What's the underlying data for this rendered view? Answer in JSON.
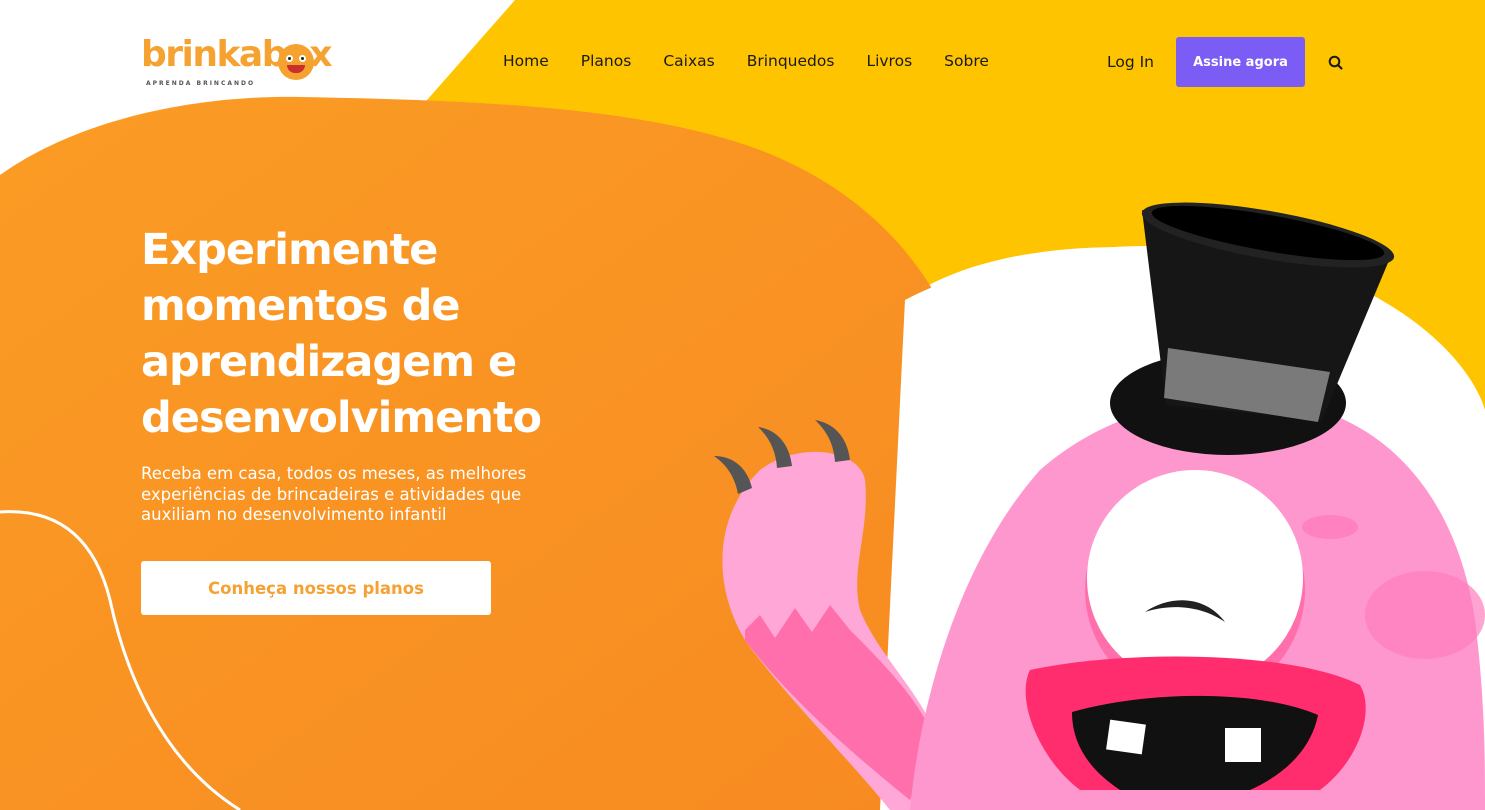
{
  "brand": {
    "name": "brinkabox",
    "tagline": "APRENDA BRINCANDO"
  },
  "nav": {
    "items": [
      {
        "label": "Home"
      },
      {
        "label": "Planos"
      },
      {
        "label": "Caixas"
      },
      {
        "label": "Brinquedos"
      },
      {
        "label": "Livros"
      },
      {
        "label": "Sobre"
      }
    ],
    "login_label": "Log In",
    "cta_label": "Assine agora",
    "search_icon": "search-icon"
  },
  "hero": {
    "title": "Experimente momentos de aprendizagem e desenvolvimento",
    "subtitle": "Receba em casa, todos os meses, as melhores experiências de brincadeiras e atividades que auxiliam no desenvolvimento infantil",
    "cta_label": "Conheça nossos planos"
  },
  "colors": {
    "orange": "#f7931e",
    "yellow": "#ffc107",
    "purple": "#7b5cf5",
    "pink": "#ff97cf",
    "white": "#ffffff"
  }
}
